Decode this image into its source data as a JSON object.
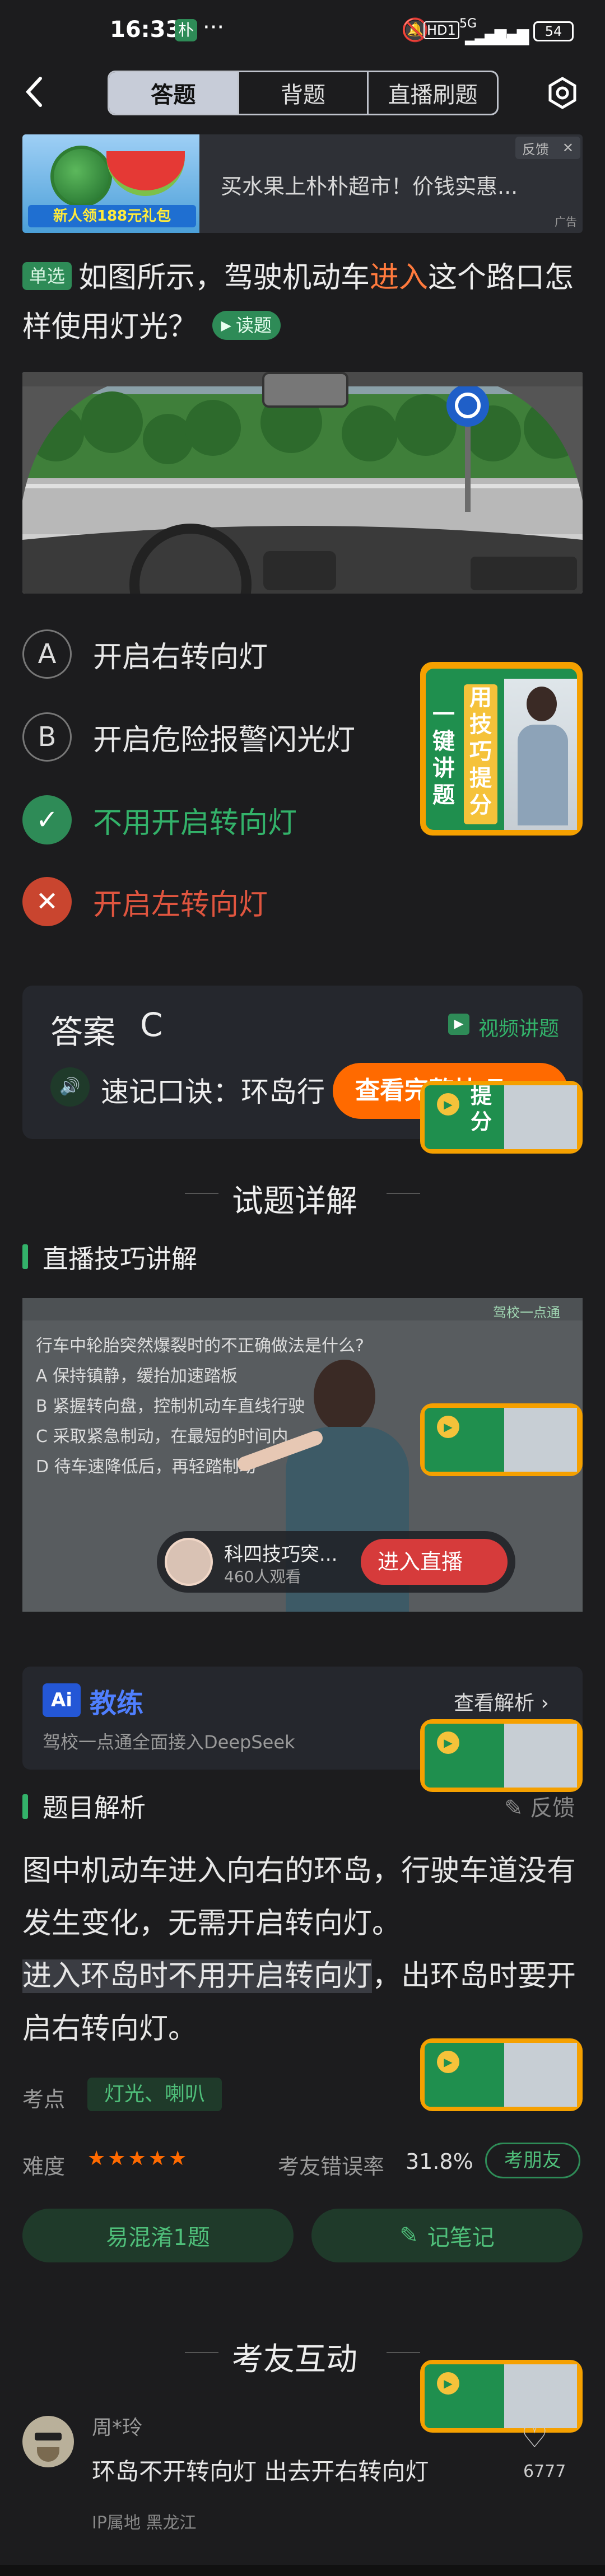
{
  "status": {
    "time": "16:33",
    "app_badge": "朴",
    "dots": "···",
    "hd": "HD1",
    "network": "5G",
    "battery": "54"
  },
  "tabs": [
    "答题",
    "背题",
    "直播刷题"
  ],
  "ad": {
    "text": "买水果上朴朴超市！价钱实惠...",
    "feedback": "反馈",
    "close": "✕",
    "badge": "广告",
    "promo": "新人领188元礼包",
    "promo_amount": "188元"
  },
  "question": {
    "type": "单选",
    "before": "如图所示，驾驶机动车",
    "highlight": "进入",
    "after": "这个路口怎样使用灯光？",
    "read": "读题"
  },
  "options": [
    {
      "letter": "A",
      "text": "开启右转向灯",
      "state": "normal"
    },
    {
      "letter": "B",
      "text": "开启危险报警闪光灯",
      "state": "normal"
    },
    {
      "letter": "✓",
      "text": "不用开启转向灯",
      "state": "correct"
    },
    {
      "letter": "✕",
      "text": "开启左转向灯",
      "state": "wrong"
    }
  ],
  "promo": {
    "col1": "一键讲题",
    "col2": "用技巧提分",
    "small": "题提分"
  },
  "answer": {
    "label": "答案",
    "value": "C",
    "video": "视频讲题",
    "mnemonic": "速记口诀：环岛行",
    "view_btn": "查看完整技巧"
  },
  "detail_title": "试题详解",
  "live_section": "直播技巧讲解",
  "video": {
    "q": "行车中轮胎突然爆裂时的不正确做法是什么?",
    "a": "保持镇静，缓抬加速踏板",
    "b": "紧握转向盘，控制机动车直线行驶",
    "c": "采取紧急制动，在最短的时间内",
    "d": "待车速降低后，再轻踏制动",
    "host": "科四技巧突...",
    "viewers": "460人观看",
    "enter": "进入直播",
    "logo": "驾校一点通"
  },
  "coach": {
    "brand": "教练",
    "ai": "Ai",
    "view": "查看解析",
    "sub": "驾校一点通全面接入DeepSeek"
  },
  "analysis": {
    "title": "题目解析",
    "feedback": "反馈",
    "p1": "图中机动车进入向右的环岛，行驶车道没有发生变化，无需开启转向灯。",
    "p2_hl": "进入环岛时不用开启转向灯",
    "p2_rest": "，出环岛时要开启右转向灯。"
  },
  "meta": {
    "kp_label": "考点",
    "kp": "灯光、喇叭",
    "diff_label": "难度",
    "err_label": "考友错误率",
    "err": "31.8%",
    "ask": "考朋友"
  },
  "buttons": {
    "confuse": "易混淆1题",
    "note": "记笔记"
  },
  "interact_title": "考友互动",
  "comment": {
    "user": "周*玲",
    "text": "环岛不开转向灯 出去开右转向灯",
    "likes": "6777",
    "ip": "IP属地 黑龙江"
  },
  "colors": {
    "green": "#2e8b57",
    "accent": "#33b26a",
    "orange": "#ff6a00",
    "wrong": "#e0553f"
  }
}
